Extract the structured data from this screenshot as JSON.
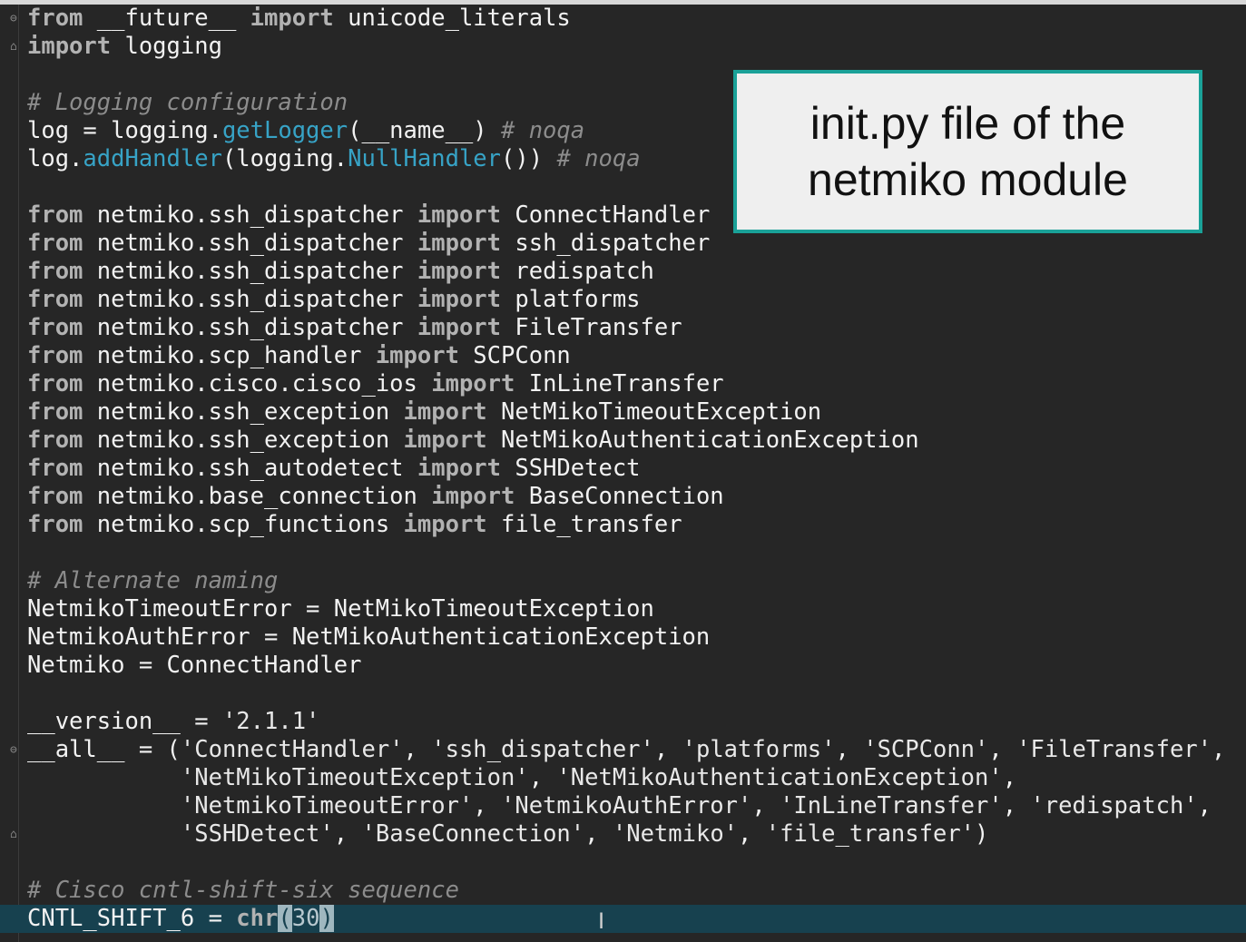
{
  "callout": {
    "line1": "init.py file of the",
    "line2": "netmiko module"
  },
  "code_lines": [
    [
      [
        "kw",
        "from"
      ],
      [
        "plain",
        " __future__ "
      ],
      [
        "kw",
        "import"
      ],
      [
        "plain",
        " unicode_literals"
      ]
    ],
    [
      [
        "kw",
        "import"
      ],
      [
        "plain",
        " logging"
      ]
    ],
    [],
    [
      [
        "cm",
        "# Logging configuration"
      ]
    ],
    [
      [
        "plain",
        "log = logging."
      ],
      [
        "fn",
        "getLogger"
      ],
      [
        "plain",
        "(__name__) "
      ],
      [
        "cm",
        "# noqa"
      ]
    ],
    [
      [
        "plain",
        "log."
      ],
      [
        "fn",
        "addHandler"
      ],
      [
        "plain",
        "(logging."
      ],
      [
        "fn",
        "NullHandler"
      ],
      [
        "plain",
        "()) "
      ],
      [
        "cm",
        "# noqa"
      ]
    ],
    [],
    [
      [
        "kw",
        "from"
      ],
      [
        "plain",
        " netmiko.ssh_dispatcher "
      ],
      [
        "kw",
        "import"
      ],
      [
        "plain",
        " ConnectHandler"
      ]
    ],
    [
      [
        "kw",
        "from"
      ],
      [
        "plain",
        " netmiko.ssh_dispatcher "
      ],
      [
        "kw",
        "import"
      ],
      [
        "plain",
        " ssh_dispatcher"
      ]
    ],
    [
      [
        "kw",
        "from"
      ],
      [
        "plain",
        " netmiko.ssh_dispatcher "
      ],
      [
        "kw",
        "import"
      ],
      [
        "plain",
        " redispatch"
      ]
    ],
    [
      [
        "kw",
        "from"
      ],
      [
        "plain",
        " netmiko.ssh_dispatcher "
      ],
      [
        "kw",
        "import"
      ],
      [
        "plain",
        " platforms"
      ]
    ],
    [
      [
        "kw",
        "from"
      ],
      [
        "plain",
        " netmiko.ssh_dispatcher "
      ],
      [
        "kw",
        "import"
      ],
      [
        "plain",
        " FileTransfer"
      ]
    ],
    [
      [
        "kw",
        "from"
      ],
      [
        "plain",
        " netmiko.scp_handler "
      ],
      [
        "kw",
        "import"
      ],
      [
        "plain",
        " SCPConn"
      ]
    ],
    [
      [
        "kw",
        "from"
      ],
      [
        "plain",
        " netmiko.cisco.cisco_ios "
      ],
      [
        "kw",
        "import"
      ],
      [
        "plain",
        " InLineTransfer"
      ]
    ],
    [
      [
        "kw",
        "from"
      ],
      [
        "plain",
        " netmiko.ssh_exception "
      ],
      [
        "kw",
        "import"
      ],
      [
        "plain",
        " NetMikoTimeoutException"
      ]
    ],
    [
      [
        "kw",
        "from"
      ],
      [
        "plain",
        " netmiko.ssh_exception "
      ],
      [
        "kw",
        "import"
      ],
      [
        "plain",
        " NetMikoAuthenticationException"
      ]
    ],
    [
      [
        "kw",
        "from"
      ],
      [
        "plain",
        " netmiko.ssh_autodetect "
      ],
      [
        "kw",
        "import"
      ],
      [
        "plain",
        " SSHDetect"
      ]
    ],
    [
      [
        "kw",
        "from"
      ],
      [
        "plain",
        " netmiko.base_connection "
      ],
      [
        "kw",
        "import"
      ],
      [
        "plain",
        " BaseConnection"
      ]
    ],
    [
      [
        "kw",
        "from"
      ],
      [
        "plain",
        " netmiko.scp_functions "
      ],
      [
        "kw",
        "import"
      ],
      [
        "plain",
        " file_transfer"
      ]
    ],
    [],
    [
      [
        "cm",
        "# Alternate naming"
      ]
    ],
    [
      [
        "plain",
        "NetmikoTimeoutError = NetMikoTimeoutException"
      ]
    ],
    [
      [
        "plain",
        "NetmikoAuthError = NetMikoAuthenticationException"
      ]
    ],
    [
      [
        "plain",
        "Netmiko = ConnectHandler"
      ]
    ],
    [],
    [
      [
        "plain",
        "__version__ = "
      ],
      [
        "str",
        "'2.1.1'"
      ]
    ],
    [
      [
        "plain",
        "__all__ = ("
      ],
      [
        "str",
        "'ConnectHandler'"
      ],
      [
        "plain",
        ", "
      ],
      [
        "str",
        "'ssh_dispatcher'"
      ],
      [
        "plain",
        ", "
      ],
      [
        "str",
        "'platforms'"
      ],
      [
        "plain",
        ", "
      ],
      [
        "str",
        "'SCPConn'"
      ],
      [
        "plain",
        ", "
      ],
      [
        "str",
        "'FileTransfer'"
      ],
      [
        "plain",
        ","
      ]
    ],
    [
      [
        "plain",
        "           "
      ],
      [
        "str",
        "'NetMikoTimeoutException'"
      ],
      [
        "plain",
        ", "
      ],
      [
        "str",
        "'NetMikoAuthenticationException'"
      ],
      [
        "plain",
        ","
      ]
    ],
    [
      [
        "plain",
        "           "
      ],
      [
        "str",
        "'NetmikoTimeoutError'"
      ],
      [
        "plain",
        ", "
      ],
      [
        "str",
        "'NetmikoAuthError'"
      ],
      [
        "plain",
        ", "
      ],
      [
        "str",
        "'InLineTransfer'"
      ],
      [
        "plain",
        ", "
      ],
      [
        "str",
        "'redispatch'"
      ],
      [
        "plain",
        ","
      ]
    ],
    [
      [
        "plain",
        "           "
      ],
      [
        "str",
        "'SSHDetect'"
      ],
      [
        "plain",
        ", "
      ],
      [
        "str",
        "'BaseConnection'"
      ],
      [
        "plain",
        ", "
      ],
      [
        "str",
        "'Netmiko'"
      ],
      [
        "plain",
        ", "
      ],
      [
        "str",
        "'file_transfer'"
      ],
      [
        "plain",
        ")"
      ]
    ],
    [],
    [
      [
        "cm",
        "# Cisco cntl-shift-six sequence"
      ]
    ],
    [
      [
        "plain",
        "CNTL_SHIFT_6 = "
      ],
      [
        "kw",
        "chr"
      ],
      [
        "bracket-hl",
        "("
      ],
      [
        "num-hl",
        "30"
      ],
      [
        "bracket-hl",
        ")"
      ]
    ]
  ],
  "current_line_index": 32,
  "fold_markers": [
    {
      "line": 0,
      "glyph": "⊖"
    },
    {
      "line": 1,
      "glyph": "⌂"
    },
    {
      "line": 26,
      "glyph": "⊖"
    },
    {
      "line": 29,
      "glyph": "⌂"
    }
  ],
  "cursor_icon": "text-cursor-icon",
  "colors": {
    "background": "#262626",
    "keyword": "#b2b2b2",
    "function": "#37a3c6",
    "comment": "#8c8c8c",
    "current_line": "#17414f",
    "callout_border": "#1aa198"
  }
}
